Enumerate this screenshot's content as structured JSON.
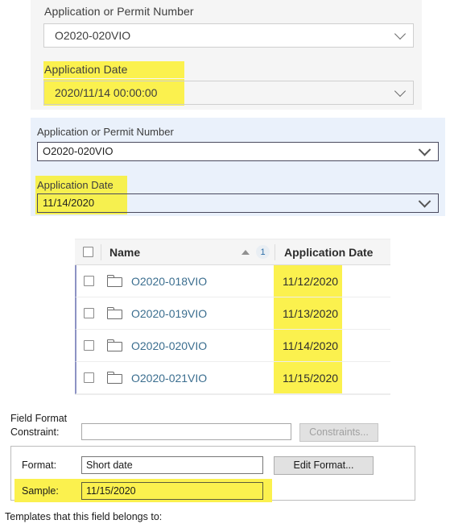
{
  "web_form_grey": {
    "permit_label": "Application or Permit Number",
    "permit_value": "O2020-020VIO",
    "date_label": "Application Date",
    "date_value": "2020/11/14 00:00:00"
  },
  "web_form_blue": {
    "permit_label": "Application or Permit Number",
    "permit_value": "O2020-020VIO",
    "date_label": "Application Date",
    "date_value": "11/14/2020"
  },
  "table": {
    "columns": [
      "Name",
      "Application Date"
    ],
    "sort_indicator": "ascending",
    "sort_badge": "1",
    "rows": [
      {
        "name": "O2020-018VIO",
        "date": "11/12/2020"
      },
      {
        "name": "O2020-019VIO",
        "date": "11/13/2020"
      },
      {
        "name": "O2020-020VIO",
        "date": "11/14/2020"
      },
      {
        "name": "O2020-021VIO",
        "date": "11/15/2020"
      }
    ]
  },
  "dialog": {
    "constraint_label": "Constraint:",
    "constraint_value": "",
    "constraints_button": "Constraints...",
    "group_title": "Field Format",
    "format_label": "Format:",
    "format_value": "Short date",
    "edit_format_button": "Edit Format...",
    "sample_label": "Sample:",
    "sample_value": "11/15/2020",
    "templates_label": "Templates that this field belongs to:"
  },
  "colors": {
    "highlight": "#fbf14e",
    "panel_blue": "#eaf1fb",
    "panel_grey": "#f5f5f5",
    "link": "#3b6e8f"
  }
}
